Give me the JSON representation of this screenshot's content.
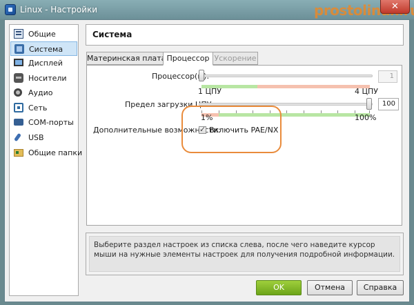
{
  "window": {
    "title": "Linux - Настройки",
    "watermark": "prostolinux.ru",
    "close_label": "✕",
    "icon": "virtualbox-icon"
  },
  "sidebar": {
    "items": [
      {
        "label": "Общие",
        "icon": "general-icon"
      },
      {
        "label": "Система",
        "icon": "system-icon",
        "selected": true
      },
      {
        "label": "Дисплей",
        "icon": "display-icon"
      },
      {
        "label": "Носители",
        "icon": "storage-icon"
      },
      {
        "label": "Аудио",
        "icon": "audio-icon"
      },
      {
        "label": "Сеть",
        "icon": "network-icon"
      },
      {
        "label": "COM-порты",
        "icon": "serial-ports-icon"
      },
      {
        "label": "USB",
        "icon": "usb-icon"
      },
      {
        "label": "Общие папки",
        "icon": "shared-folders-icon"
      }
    ]
  },
  "header": {
    "title": "Система"
  },
  "tabs": [
    {
      "label": "Материнская плата",
      "state": "normal"
    },
    {
      "label": "Процессор",
      "state": "active"
    },
    {
      "label": "Ускорение",
      "state": "disabled"
    }
  ],
  "processor": {
    "cpu_label": "Процессор(ы):",
    "cpu_value": "1",
    "cpu_min_label": "1 ЦПУ",
    "cpu_max_label": "4 ЦПУ",
    "cpu_fraction": 0,
    "cap_label": "Предел загрузки ЦПУ:",
    "cap_value": "100",
    "cap_min_label": "1%",
    "cap_max_label": "100%",
    "cap_fraction": 1,
    "ext_label": "Дополнительные возможности:",
    "pae_label": "Включить PAE/NX",
    "pae_checked": true
  },
  "info": {
    "text": "Выберите раздел настроек из списка слева, после чего наведите курсор мыши на нужные элементы настроек для получения подробной информации."
  },
  "buttons": {
    "ok": "OK",
    "cancel": "Отмена",
    "help": "Справка"
  },
  "colors": {
    "ok_button": "#7db324",
    "highlight": "#e98b3b",
    "title_bar": "#7aa0a8"
  }
}
